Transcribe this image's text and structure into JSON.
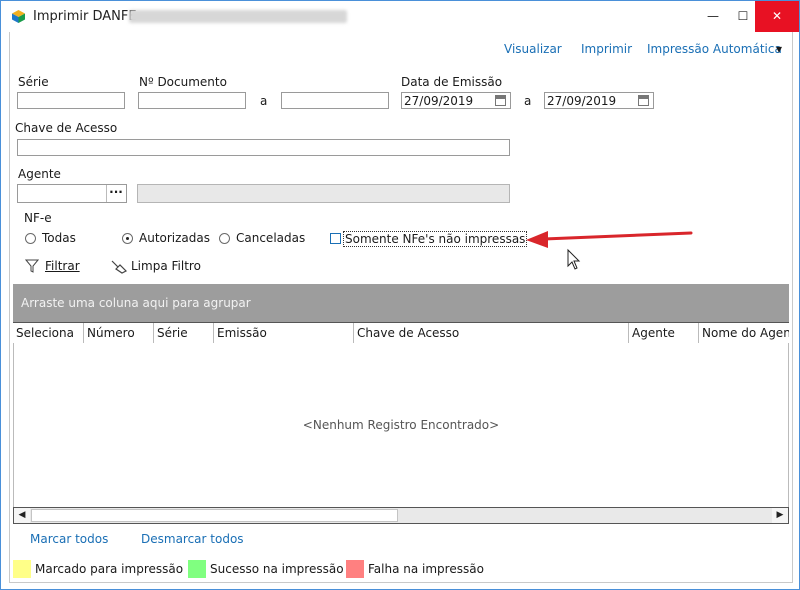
{
  "window": {
    "title": "Imprimir DANFE",
    "minimize_symbol": "—",
    "maximize_symbol": "☐",
    "close_symbol": "✕"
  },
  "toolbar": {
    "visualizar": "Visualizar",
    "imprimir": "Imprimir",
    "impressao_automatica": "Impressão Automática",
    "dropdown_arrow": "▾"
  },
  "filters": {
    "serie_label": "Série",
    "serie_value": "",
    "ndoc_label": "Nº Documento",
    "ndoc_from": "",
    "ndoc_to": "",
    "range_sep": "a",
    "data_emissao_label": "Data de Emissão",
    "data_from": "27/09/2019",
    "data_to": "27/09/2019",
    "chave_label": "Chave de Acesso",
    "chave_value": "",
    "agente_label": "Agente",
    "agente_value": "",
    "agente_button": "···",
    "agente_name": ""
  },
  "nfe": {
    "label": "NF-e",
    "options": [
      {
        "label": "Todas",
        "selected": false
      },
      {
        "label": "Autorizadas",
        "selected": true
      },
      {
        "label": "Canceladas",
        "selected": false
      }
    ],
    "somente_label": "Somente NFe's não impressas",
    "somente_checked": false
  },
  "actions": {
    "filtrar": "Filtrar",
    "limpa_filtro": "Limpa Filtro"
  },
  "grid": {
    "group_hint": "Arraste uma coluna aqui para agrupar",
    "columns": [
      "Seleciona",
      "Número",
      "Série",
      "Emissão",
      "Chave de Acesso",
      "Agente",
      "Nome do Agente"
    ],
    "empty_text": "<Nenhum Registro Encontrado>",
    "scroll_left": "◀",
    "scroll_right": "▶"
  },
  "selection": {
    "marcar_todos": "Marcar todos",
    "desmarcar_todos": "Desmarcar todos"
  },
  "legend": [
    {
      "label": "Marcado para impressão",
      "color": "#ffff88"
    },
    {
      "label": "Sucesso na impressão",
      "color": "#80ff80"
    },
    {
      "label": "Falha na impressão",
      "color": "#ff8080"
    }
  ],
  "colors": {
    "link": "#1a6fb5",
    "close_button": "#e81123",
    "annotation_arrow": "#d9262b"
  }
}
